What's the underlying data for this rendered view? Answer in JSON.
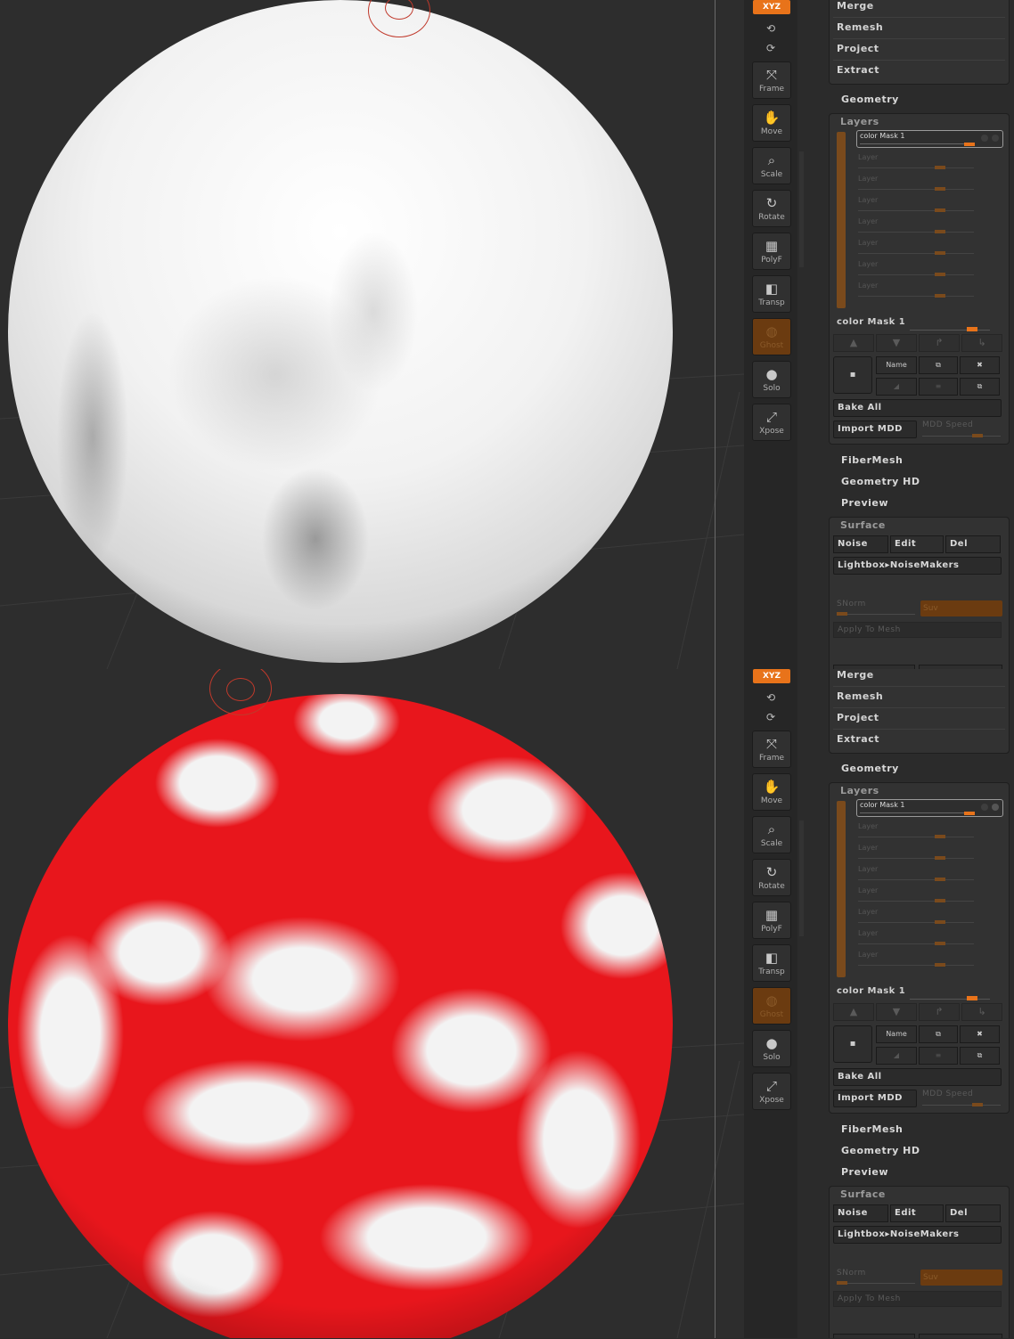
{
  "colors": {
    "accent": "#e8731a",
    "mask_red": "#e8161c",
    "ghost": "#6b3b10"
  },
  "shelf": {
    "xyz": "XYZ",
    "buttons": [
      {
        "label": "Frame",
        "icon": "frame-icon",
        "glyph": "⤧"
      },
      {
        "label": "Move",
        "icon": "hand-icon",
        "glyph": "✋"
      },
      {
        "label": "Scale",
        "icon": "magnifier-icon",
        "glyph": "⌕"
      },
      {
        "label": "Rotate",
        "icon": "rotate-icon",
        "glyph": "↻"
      },
      {
        "label": "PolyF",
        "icon": "grid-icon",
        "glyph": "▦"
      },
      {
        "label": "Transp",
        "icon": "transparency-icon",
        "glyph": "◧"
      },
      {
        "label": "Ghost",
        "icon": "ghost-icon",
        "glyph": "◍"
      },
      {
        "label": "Solo",
        "icon": "solo-icon",
        "glyph": "●"
      },
      {
        "label": "Xpose",
        "icon": "xpose-icon",
        "glyph": "⤢"
      }
    ]
  },
  "sidebar": {
    "top_menu": [
      "Merge",
      "Remesh",
      "Project",
      "Extract"
    ],
    "geometry": "Geometry",
    "layers": {
      "title": "Layers",
      "selected_layer": "color  Mask 1",
      "layer_rows": [
        "Layer",
        "Layer",
        "Layer",
        "Layer",
        "Layer",
        "Layer",
        "Layer"
      ],
      "current_name": "color  Mask 1",
      "name_button": "Name",
      "bake_all": "Bake  All",
      "import_mdd": "Import  MDD",
      "mdd_speed": "MDD  Speed"
    },
    "sections": [
      "FiberMesh",
      "Geometry  HD",
      "Preview"
    ],
    "surface": {
      "title": "Surface",
      "noise": "Noise",
      "edit": "Edit",
      "del": "Del",
      "lightbox": "Lightbox▸NoiseMakers",
      "snorm": "SNorm",
      "suv": "Suv",
      "apply": "Apply  To  Mesh"
    }
  }
}
